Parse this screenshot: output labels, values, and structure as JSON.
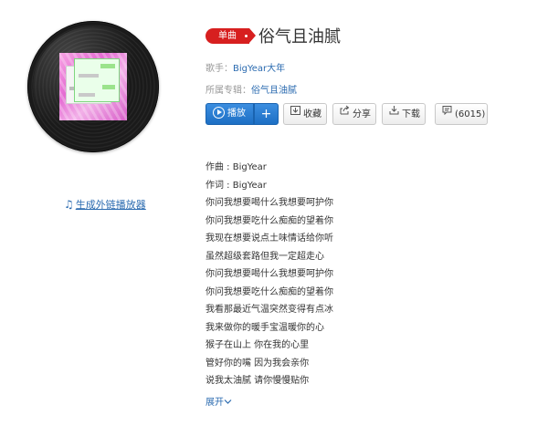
{
  "song": {
    "tag": "单曲",
    "title": "俗气且油腻",
    "singer_label": "歌手：",
    "singer": "BigYear大年",
    "album_label": "所属专辑：",
    "album": "俗气且油腻"
  },
  "buttons": {
    "play": "播放",
    "plus": "+",
    "collect": "收藏",
    "share": "分享",
    "download": "下载",
    "comments": "(6015)"
  },
  "icons": {
    "play": "play-circle-icon",
    "collect": "collect-box-icon",
    "share": "share-arrow-icon",
    "download": "download-icon",
    "comment": "comment-bubble-icon",
    "note": "music-note-icon"
  },
  "player_link": "生成外链播放器",
  "lyrics": [
    "作曲 : BigYear",
    "作词 : BigYear",
    "你问我想要喝什么我想要呵护你",
    "你问我想要吃什么痴痴的望着你",
    "我现在想要说点土味情话给你听",
    "虽然超级套路但我一定超走心",
    "你问我想要喝什么我想要呵护你",
    "你问我想要吃什么痴痴的望着你",
    "我看那最近气温突然变得有点冰",
    "我来做你的暖手宝温暖你的心",
    "猴子在山上 你在我的心里",
    "管好你的嘴 因为我会亲你",
    "说我太油腻 请你慢慢贴你"
  ],
  "expand": "展开",
  "colors": {
    "accent_blue": "#2b6bb0",
    "tag_red": "#d71f1f",
    "play_blue": "#1d6fc4"
  }
}
